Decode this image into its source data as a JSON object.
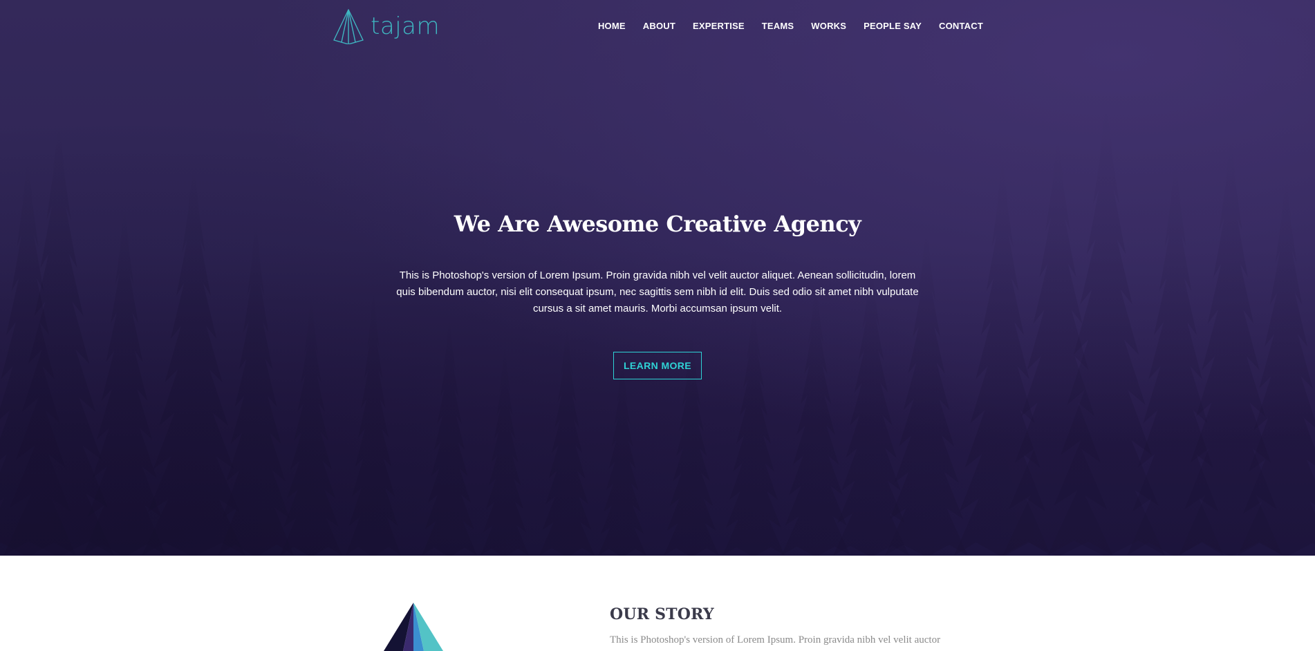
{
  "brand": {
    "name": "tajam",
    "accent": "#3fb6c1",
    "icon": "pyramid-outline-icon"
  },
  "nav": {
    "items": [
      "HOME",
      "ABOUT",
      "EXPERTISE",
      "TEAMS",
      "WORKS",
      "PEOPLE SAY",
      "CONTACT"
    ]
  },
  "hero": {
    "title": "We Are Awesome Creative Agency",
    "text": "This is Photoshop's version of Lorem Ipsum. Proin gravida nibh vel velit auctor aliquet. Aenean sollicitudin, lorem quis bibendum auctor, nisi elit consequat ipsum, nec sagittis sem nibh id elit. Duis sed odio sit amet nibh vulputate cursus a sit amet mauris. Morbi accumsan ipsum velit.",
    "button_label": "LEARN MORE",
    "button_color": "#2fd3d6",
    "background_color": "#2b2150"
  },
  "story": {
    "heading": "OUR STORY",
    "text": "This is Photoshop's version of Lorem Ipsum. Proin gravida nibh vel velit auctor",
    "art_icon": "pyramid-illustration"
  }
}
